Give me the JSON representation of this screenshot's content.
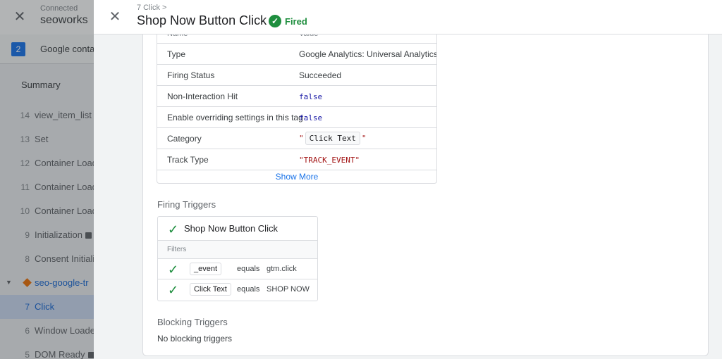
{
  "sidebar": {
    "connected_label": "Connected",
    "site_name": "seoworks",
    "container_badge": "2",
    "container_name": "Google conta",
    "summary_label": "Summary",
    "events": [
      {
        "num": "14",
        "label": "view_item_list"
      },
      {
        "num": "13",
        "label": "Set"
      },
      {
        "num": "12",
        "label": "Container Load"
      },
      {
        "num": "11",
        "label": "Container Load"
      },
      {
        "num": "10",
        "label": "Container Load"
      },
      {
        "num": "9",
        "label": "Initialization"
      },
      {
        "num": "8",
        "label": "Consent Initializ"
      }
    ],
    "group_label": "seo-google-tr",
    "sub_events": [
      {
        "num": "7",
        "label": "Click"
      },
      {
        "num": "6",
        "label": "Window Loaded"
      },
      {
        "num": "5",
        "label": "DOM Ready"
      }
    ]
  },
  "panel": {
    "breadcrumb": "7 Click >",
    "title": "Shop Now Button Click",
    "status": "Fired",
    "properties_header": {
      "name": "Name",
      "value": "Value"
    },
    "properties": [
      {
        "name": "Type",
        "value": "Google Analytics: Universal Analytics"
      },
      {
        "name": "Firing Status",
        "value": "Succeeded"
      },
      {
        "name": "Non-Interaction Hit",
        "value": "false"
      },
      {
        "name": "Enable overriding settings in this tag",
        "value": "false"
      },
      {
        "name": "Category",
        "quote": "\"",
        "value": "Click Text"
      },
      {
        "name": "Track Type",
        "value": "\"TRACK_EVENT\""
      }
    ],
    "show_more": "Show More",
    "firing_triggers_title": "Firing Triggers",
    "trigger": {
      "name": "Shop Now Button Click",
      "filters_label": "Filters",
      "filters": [
        {
          "variable": "_event",
          "operator": "equals",
          "value": "gtm.click"
        },
        {
          "variable": "Click Text",
          "operator": "equals",
          "value": "SHOP NOW"
        }
      ]
    },
    "blocking_triggers_title": "Blocking Triggers",
    "blocking_triggers_none": "No blocking triggers"
  }
}
